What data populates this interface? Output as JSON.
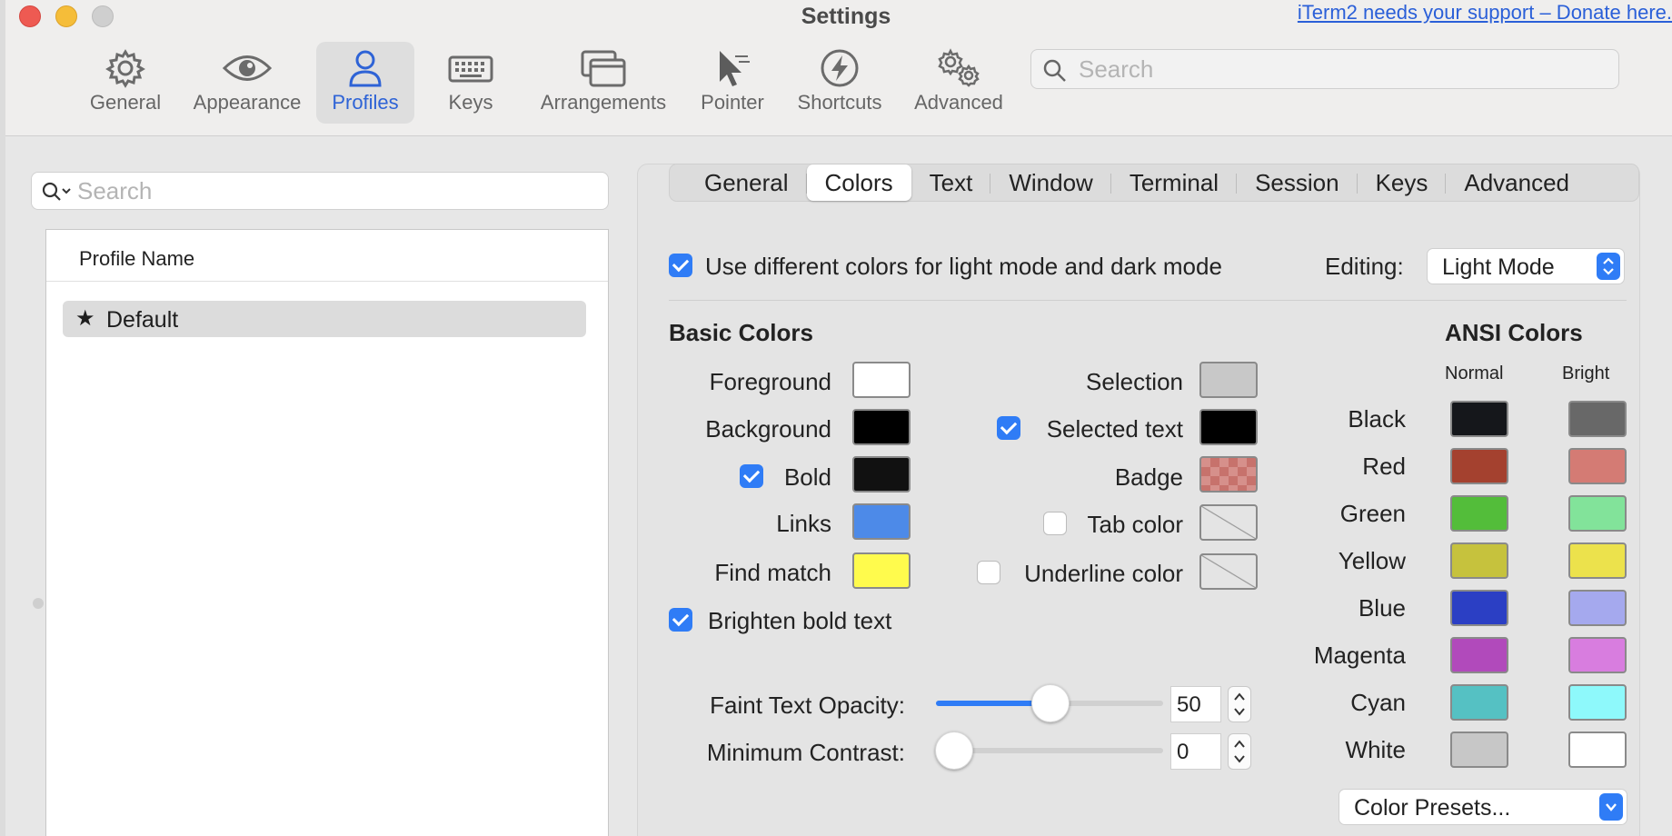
{
  "window": {
    "title": "Settings",
    "donate_link": "iTerm2 needs your support – Donate here."
  },
  "toolbar": {
    "items": [
      {
        "label": "General",
        "icon": "gear-icon"
      },
      {
        "label": "Appearance",
        "icon": "eye-icon"
      },
      {
        "label": "Profiles",
        "icon": "person-icon",
        "active": true
      },
      {
        "label": "Keys",
        "icon": "keyboard-icon"
      },
      {
        "label": "Arrangements",
        "icon": "windows-icon"
      },
      {
        "label": "Pointer",
        "icon": "cursor-icon"
      },
      {
        "label": "Shortcuts",
        "icon": "bolt-icon"
      },
      {
        "label": "Advanced",
        "icon": "gears-icon"
      }
    ],
    "search_placeholder": "Search"
  },
  "profiles": {
    "search_placeholder": "Search",
    "column_header": "Profile Name",
    "items": [
      {
        "name": "Default",
        "default": true
      }
    ]
  },
  "subtabs": {
    "items": [
      "General",
      "Colors",
      "Text",
      "Window",
      "Terminal",
      "Session",
      "Keys",
      "Advanced"
    ],
    "active": "Colors"
  },
  "colors": {
    "light_dark_checkbox": {
      "label": "Use different colors for light mode and dark mode",
      "checked": true
    },
    "editing_label": "Editing:",
    "editing_value": "Light Mode",
    "basic_heading": "Basic Colors",
    "basic_left": [
      {
        "label": "Foreground",
        "color": "#ffffff"
      },
      {
        "label": "Background",
        "color": "#000000"
      },
      {
        "label": "Bold",
        "color": "#111111",
        "checkbox": true
      },
      {
        "label": "Links",
        "color": "#4d8ae8"
      },
      {
        "label": "Find match",
        "color": "#fffb4d"
      }
    ],
    "basic_right": [
      {
        "label": "Selection",
        "color": "#c8c8c8"
      },
      {
        "label": "Selected text",
        "color": "#000000",
        "checkbox": true
      },
      {
        "label": "Badge",
        "color": "#d6908b",
        "pattern": "checker"
      },
      {
        "label": "Tab color",
        "color": "none",
        "checkbox": false
      },
      {
        "label": "Underline color",
        "color": "none",
        "checkbox": false
      }
    ],
    "brighten_bold": {
      "label": "Brighten bold text",
      "checked": true
    },
    "faint_opacity": {
      "label": "Faint Text Opacity:",
      "value": "50",
      "fraction": 0.5
    },
    "min_contrast": {
      "label": "Minimum Contrast:",
      "value": "0",
      "fraction": 0.0
    },
    "ansi_heading": "ANSI Colors",
    "ansi_normal_label": "Normal",
    "ansi_bright_label": "Bright",
    "ansi": [
      {
        "name": "Black",
        "normal": "#15171b",
        "bright": "#686868"
      },
      {
        "name": "Red",
        "normal": "#a4412f",
        "bright": "#d47b74"
      },
      {
        "name": "Green",
        "normal": "#53bd3a",
        "bright": "#82e39a"
      },
      {
        "name": "Yellow",
        "normal": "#c6c23d",
        "bright": "#ece24c"
      },
      {
        "name": "Blue",
        "normal": "#2b3fc4",
        "bright": "#a5a9ee"
      },
      {
        "name": "Magenta",
        "normal": "#b14abb",
        "bright": "#d87ddf"
      },
      {
        "name": "Cyan",
        "normal": "#55c1c3",
        "bright": "#8ef9fb"
      },
      {
        "name": "White",
        "normal": "#c7c7c7",
        "bright": "#ffffff"
      }
    ],
    "presets_label": "Color Presets..."
  },
  "accent_color": "#2f7cf6"
}
